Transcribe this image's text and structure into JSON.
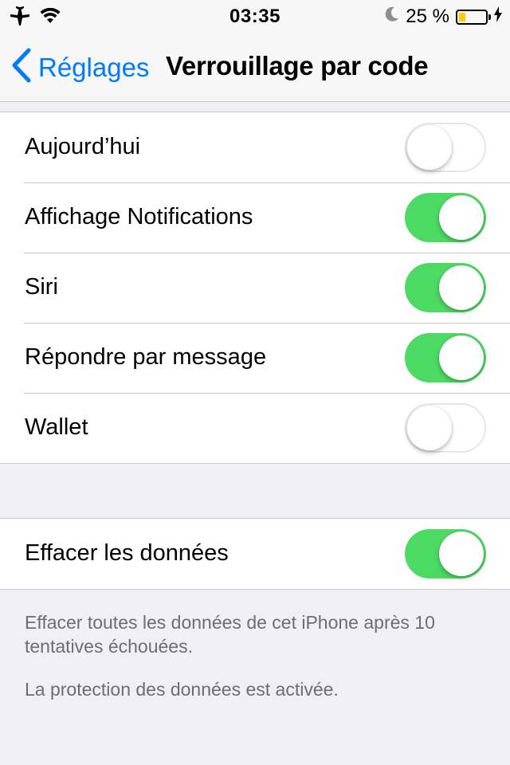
{
  "status_bar": {
    "time": "03:35",
    "battery_percent": "25 %",
    "battery_level": 0.25,
    "battery_color": "#ffcc00",
    "icons": [
      "airplane-icon",
      "wifi-icon",
      "moon-icon",
      "battery-icon",
      "charging-bolt-icon"
    ]
  },
  "nav": {
    "back_label": "Réglages",
    "title": "Verrouillage par code",
    "accent_color": "#007aff"
  },
  "settings": [
    {
      "label": "Aujourd’hui",
      "on": false
    },
    {
      "label": "Affichage Notifications",
      "on": true
    },
    {
      "label": "Siri",
      "on": true
    },
    {
      "label": "Répondre par message",
      "on": true
    },
    {
      "label": "Wallet",
      "on": false
    }
  ],
  "erase": {
    "label": "Effacer les données",
    "on": true
  },
  "footer": {
    "erase_note": "Effacer toutes les données de cet iPhone après 10 tentatives échouées.",
    "protection_note": "La protection des données est activée."
  },
  "switch_on_color": "#4cd964"
}
